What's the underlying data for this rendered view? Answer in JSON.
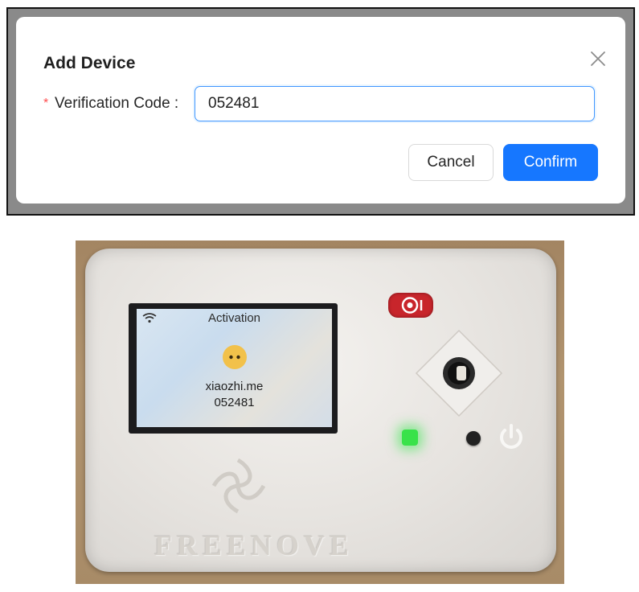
{
  "dialog": {
    "title": "Add Device",
    "required_mark": "*",
    "field_label": "Verification Code :",
    "code_value": "052481",
    "cancel_label": "Cancel",
    "confirm_label": "Confirm",
    "close_icon": "close-icon",
    "accent_color": "#1677ff"
  },
  "device": {
    "screen_status": "Activation",
    "screen_url": "xiaozhi.me",
    "screen_code": "052481",
    "wifi_icon": "wifi-icon",
    "face_icon": "emoji-face-icon",
    "brand": "FREENOVE",
    "led_color": "#39e24a"
  }
}
